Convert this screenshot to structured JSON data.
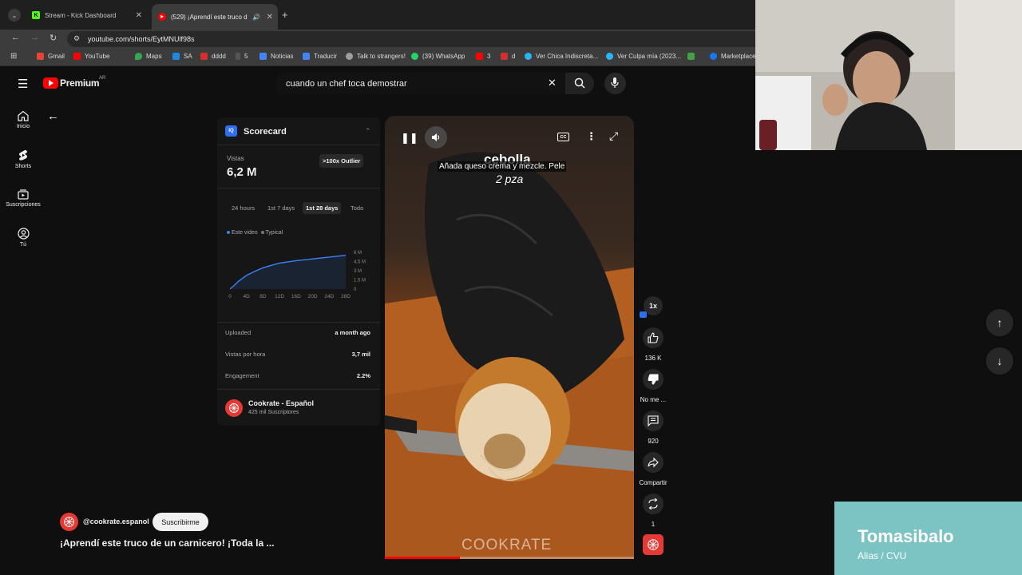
{
  "browser": {
    "tabs": [
      {
        "title": "Stream - Kick Dashboard",
        "favicon": "K",
        "color": "#53fc18"
      },
      {
        "title": "(529) ¡Aprendí este truco d",
        "favicon": "▶",
        "color": "#ff0000"
      }
    ],
    "url": "youtube.com/shorts/EytMNUlf98s",
    "bookmarks": [
      {
        "label": "Gmail",
        "color": "#ea4335"
      },
      {
        "label": "YouTube",
        "color": "#ff0000"
      },
      {
        "label": "Maps",
        "color": "#34a853"
      },
      {
        "label": "SA",
        "color": "#1e88e5"
      },
      {
        "label": "dddd",
        "color": "#d32f2f"
      },
      {
        "label": "5",
        "color": "#3c3c3c"
      },
      {
        "label": "Noticias",
        "color": "#4285f4"
      },
      {
        "label": "Traducir",
        "color": "#4285f4"
      },
      {
        "label": "Talk to strangers!",
        "color": "#9e9e9e"
      },
      {
        "label": "(39) WhatsApp",
        "color": "#25d366"
      },
      {
        "label": "3",
        "color": "#ff0000"
      },
      {
        "label": "d",
        "color": "#d32f2f"
      },
      {
        "label": "Ver Chica Indiscreta...",
        "color": "#29b6f6"
      },
      {
        "label": "Ver Culpa mía (2023...",
        "color": "#29b6f6"
      },
      {
        "label": "",
        "color": "#43a047"
      },
      {
        "label": "Marketplace",
        "color": "#1877f2"
      }
    ]
  },
  "youtube": {
    "logo": "Premium",
    "logo_sup": "AR",
    "search_value": "cuando un chef toca demostrar",
    "sidebar": [
      {
        "label": "Inicio",
        "icon": "home-icon"
      },
      {
        "label": "Shorts",
        "icon": "shorts-icon"
      },
      {
        "label": "Suscripciones",
        "icon": "subscriptions-icon"
      },
      {
        "label": "Tú",
        "icon": "you-icon"
      }
    ]
  },
  "scorecard": {
    "title": "Scorecard",
    "views_label": "Vistas",
    "views_value": "6,2 M",
    "outlier_badge": ">100x Outlier",
    "ranges": [
      "24 hours",
      "1st 7 days",
      "1st 28 days",
      "Todo"
    ],
    "active_range": "1st 28 days",
    "legend": [
      "Este video",
      "Typical"
    ],
    "stats": [
      {
        "label": "Uploaded",
        "value": "a month ago"
      },
      {
        "label": "Vistas por hora",
        "value": "3,7 mil"
      },
      {
        "label": "Engagement",
        "value": "2.2%"
      }
    ],
    "channel_name": "Cookrate - Español",
    "channel_subs": "425 mil Suscriptores"
  },
  "chart_data": {
    "type": "line",
    "x_ticks": [
      "0",
      "4D",
      "8D",
      "12D",
      "16D",
      "20D",
      "24D",
      "28D"
    ],
    "y_ticks": [
      "6 M",
      "4.5 M",
      "3 M",
      "1.5 M",
      "0"
    ],
    "ylim": [
      0,
      6.2
    ],
    "xlim": [
      0,
      28
    ],
    "series": [
      {
        "name": "Este video",
        "x": [
          0,
          1,
          2,
          4,
          6,
          8,
          10,
          12,
          16,
          20,
          24,
          28
        ],
        "y": [
          0,
          0.6,
          1.3,
          2.3,
          3.0,
          3.6,
          4.0,
          4.4,
          4.8,
          5.1,
          5.4,
          5.7
        ]
      }
    ],
    "grid": false,
    "legend_position": "top-left"
  },
  "video": {
    "caption_line1": "Añada queso crema y mezcle. Pele",
    "caption_behind": "cebolla",
    "caption_line2": "2 pza",
    "watermark": "COOKRATE",
    "channel_handle": "@cookrate.espanol",
    "subscribe_label": "Suscribirme",
    "title": "¡Aprendí este truco de un carnicero! ¡Toda la ...",
    "speed": "1x",
    "likes": "136 K",
    "dislike_label": "No me ...",
    "comments": "920",
    "share_label": "Compartir",
    "remix_count": "1"
  },
  "overlay": {
    "name": "Tomasibalo",
    "subtitle": "Alias / CVU"
  }
}
